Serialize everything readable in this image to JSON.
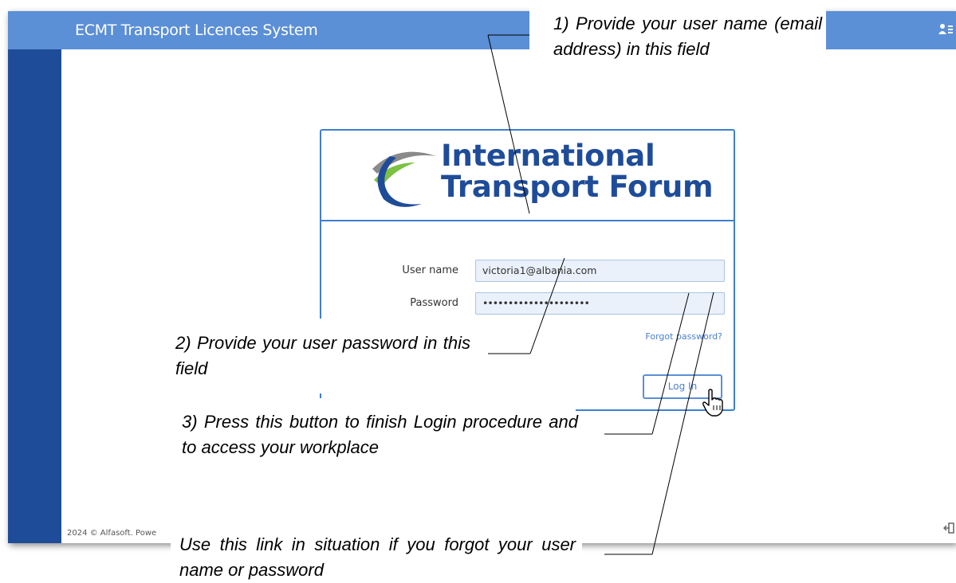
{
  "app": {
    "title": "ECMT Transport Licences System",
    "footer": "2024 © Alfasoft. Powe"
  },
  "logo": {
    "line1": "International",
    "line2": "Transport Forum"
  },
  "login": {
    "username_label": "User name",
    "username_value": "victoria1@albania.com",
    "password_label": "Password",
    "password_value": "•••••••••••••••••••••",
    "forgot_link": "Forgot password?",
    "login_button": "Log In"
  },
  "callouts": {
    "c1": "1) Provide your user name (email address) in this field",
    "c2": "2) Provide your user password in this field",
    "c3": "3) Press this button to finish Login procedure and to access your workplace",
    "c4": "Use this link in situation if you forgot your user name or password"
  },
  "colors": {
    "topbar": "#5b8fd6",
    "sidebar": "#1f4c99",
    "accent": "#3f7fcf"
  }
}
